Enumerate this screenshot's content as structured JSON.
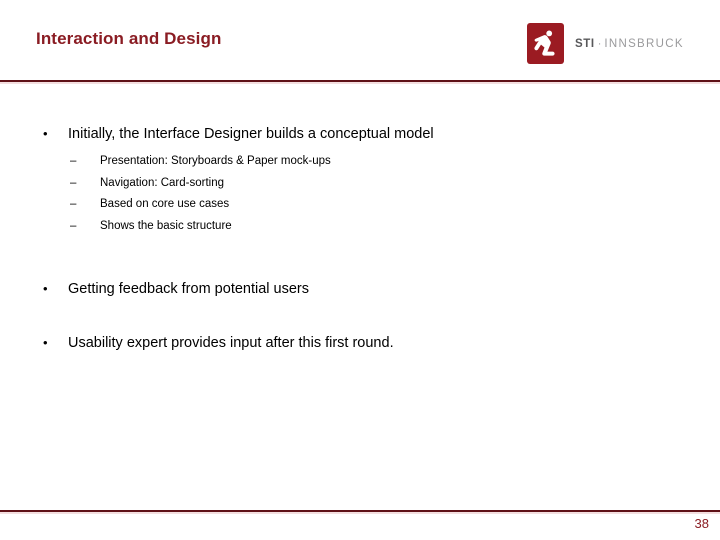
{
  "header": {
    "title": "Interaction and Design",
    "logo": {
      "icon_name": "sti-person-icon",
      "sti_text": "STI",
      "separator": "·",
      "innsbruck_text": "INNSBRUCK"
    }
  },
  "theme": {
    "accent_dark_red": "#5E1016",
    "title_red": "#8A1C23",
    "logo_red": "#9B1B22",
    "rule_shadow_pink": "#F3DEDF",
    "body_text": "#000000",
    "wordmark_gray": "#9a9a9c"
  },
  "body": {
    "bullet_marker": "•",
    "sub_bullet_marker": "–",
    "bullets": [
      {
        "text": "Initially, the Interface Designer builds a conceptual model",
        "sub_items": [
          "Presentation: Storyboards & Paper mock-ups",
          "Navigation: Card-sorting",
          "Based on core use cases",
          "Shows the basic structure"
        ]
      },
      {
        "text": "Getting feedback from potential users",
        "sub_items": []
      },
      {
        "text": "Usability expert provides input after this first round.",
        "sub_items": []
      }
    ]
  },
  "footer": {
    "page_number": "38"
  }
}
